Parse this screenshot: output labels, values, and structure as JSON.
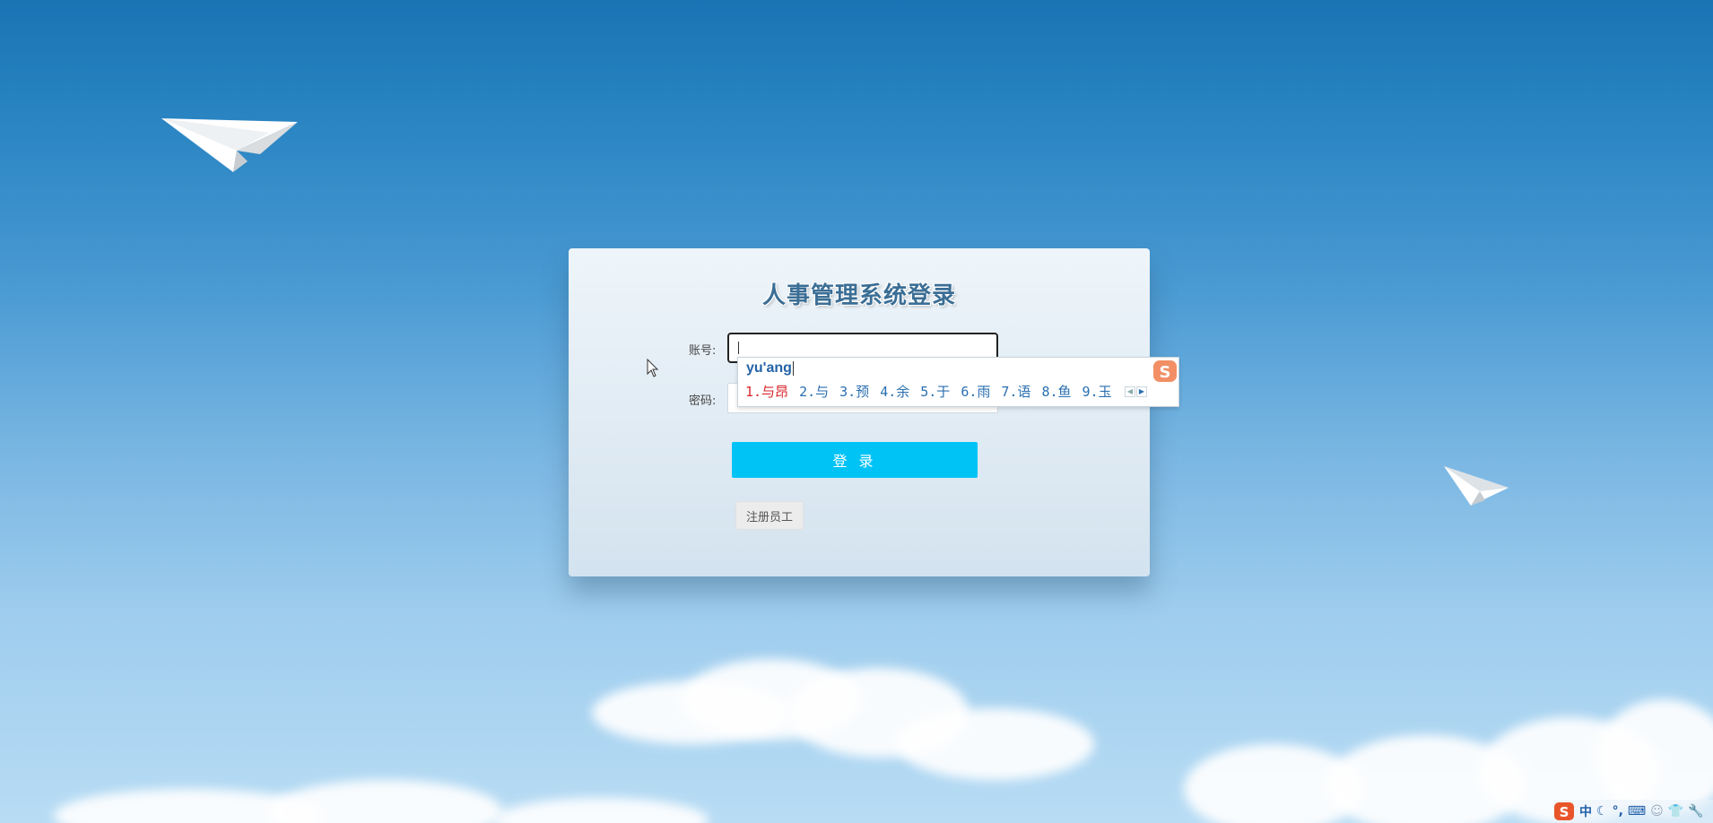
{
  "login": {
    "title": "人事管理系统登录",
    "account_label": "账号:",
    "account_value": "",
    "password_label": "密码:",
    "password_value": "",
    "login_button": "登 录",
    "register_button": "注册员工"
  },
  "ime": {
    "composition": "yu'ang",
    "candidates": [
      "1.与昂",
      "2.与",
      "3.预",
      "4.余",
      "5.于",
      "6.雨",
      "7.语",
      "8.鱼",
      "9.玉"
    ],
    "selected_index": 0,
    "logo_letter": "S",
    "prev_icon": "triangle-left-icon",
    "next_icon": "triangle-right-icon"
  },
  "ime_status_bar": {
    "logo_letter": "S",
    "items": [
      "中",
      "☾",
      "°,",
      "⌨",
      "☺",
      "👕",
      "🔧"
    ]
  },
  "colors": {
    "login_button": "#00c3f5",
    "title": "#3b6e95",
    "candidate_selected": "#d9262b",
    "candidate": "#2a6fb0"
  }
}
